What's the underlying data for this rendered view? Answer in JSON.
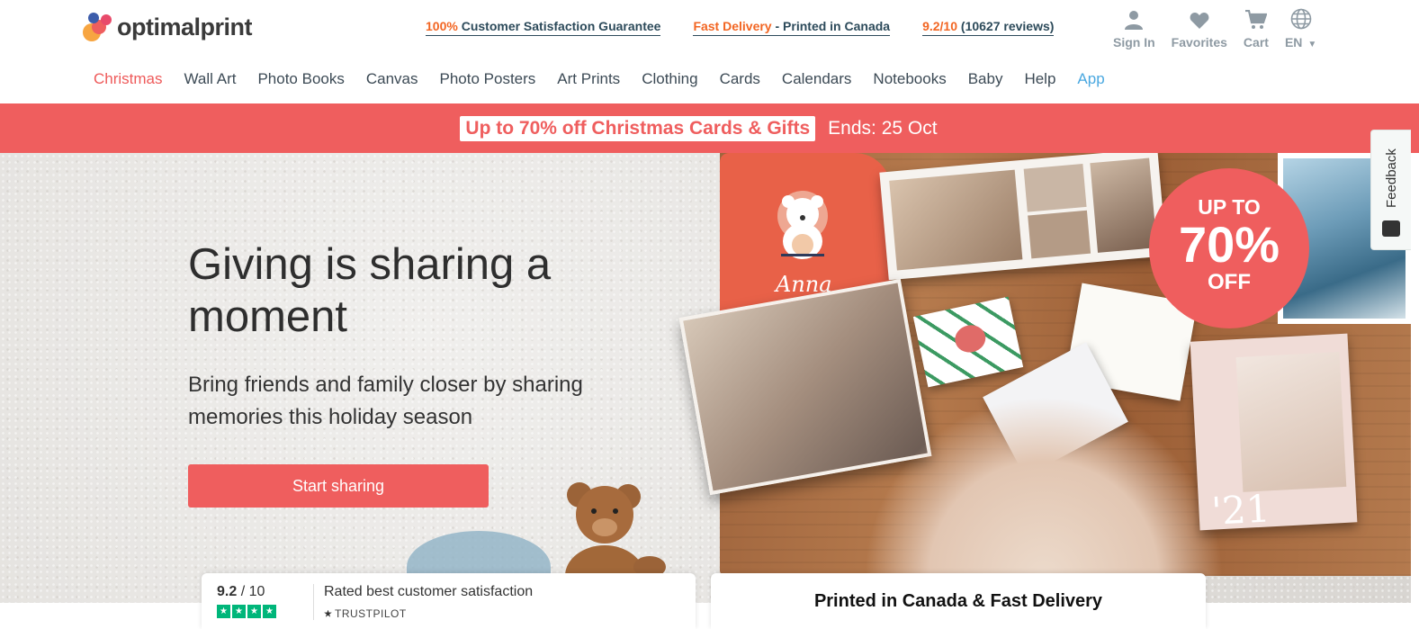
{
  "brand": {
    "name": "optimalprint",
    "colors": {
      "accent": "#ef5e5e",
      "orange": "#f26522",
      "link": "#4aa8e0",
      "trustpilot": "#00b67a"
    }
  },
  "usps": [
    {
      "highlight": "100%",
      "text": " Customer Satisfaction Guarantee"
    },
    {
      "highlight": "Fast Delivery",
      "text": " - Printed in Canada"
    },
    {
      "highlight": "9.2/10",
      "text": " (10627 reviews)"
    }
  ],
  "utility": {
    "sign_in": "Sign In",
    "favorites": "Favorites",
    "cart": "Cart",
    "language": "EN"
  },
  "nav": {
    "items": [
      "Christmas",
      "Wall Art",
      "Photo Books",
      "Canvas",
      "Photo Posters",
      "Art Prints",
      "Clothing",
      "Cards",
      "Calendars",
      "Notebooks",
      "Baby",
      "Help",
      "App"
    ]
  },
  "promo": {
    "offer": "Up to 70% off Christmas Cards & Gifts",
    "ends": "Ends: 25 Oct"
  },
  "hero": {
    "title": "Giving is sharing a moment",
    "subtitle": "Bring friends and family closer by sharing memories this holiday season",
    "cta": "Start sharing",
    "badge": {
      "line1": "UP TO",
      "line2": "70%",
      "line3": "OFF"
    },
    "shirt_name": "Anna",
    "calendar_year": "'21"
  },
  "feedback": {
    "label": "Feedback"
  },
  "rating_card": {
    "score": "9.2",
    "scale": " / 10",
    "stars": 4,
    "caption": "Rated best customer satisfaction",
    "provider": "TRUSTPILOT"
  },
  "delivery_card": {
    "title": "Printed in Canada & Fast Delivery"
  }
}
